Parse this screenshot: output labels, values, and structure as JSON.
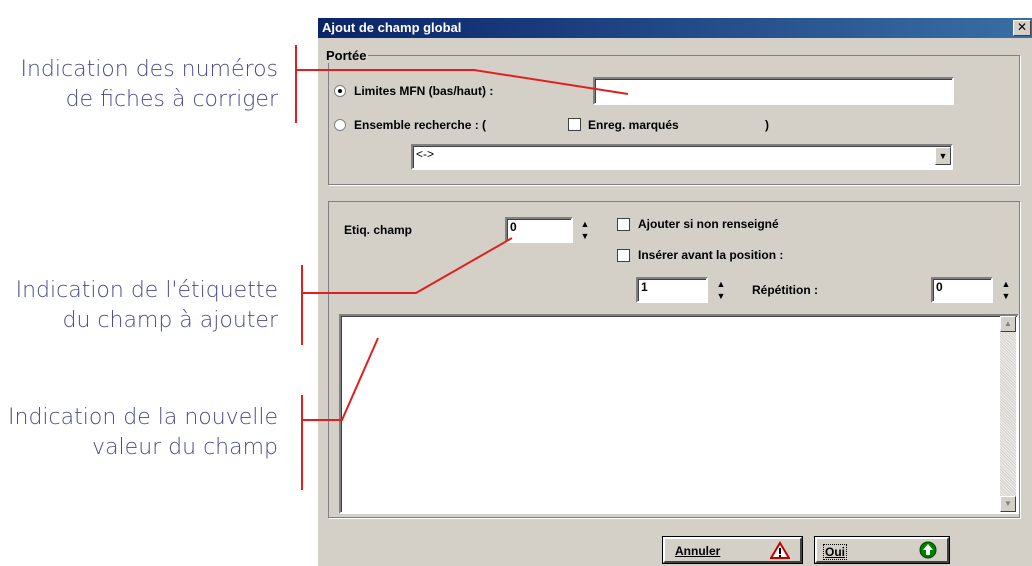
{
  "annotations": {
    "mfn_line1": "Indication des numéros",
    "mfn_line2": "de fiches à corriger",
    "tag_line1": "Indication de l'étiquette",
    "tag_line2": "du champ à ajouter",
    "value_line1": "Indication de la nouvelle",
    "value_line2": "valeur du champ"
  },
  "dialog": {
    "title": "Ajout de champ global",
    "close": "✕",
    "scope": {
      "legend": "Portée",
      "mfn_limits_label": "Limites MFN (bas/haut) :",
      "mfn_limits_value": "",
      "search_set_label": "Ensemble recherche : (",
      "marked_label": "Enreg. marqués",
      "close_paren": ")",
      "search_set_select": "<->",
      "mfn_selected": true
    },
    "field": {
      "tag_label": "Etiq. champ",
      "tag_value": "0",
      "add_if_empty_label": "Ajouter si non renseigné",
      "insert_before_label": "Insérer avant la position :",
      "position_value": "1",
      "repetition_label": "Répétition :",
      "repetition_value": "0",
      "new_value": ""
    },
    "buttons": {
      "cancel": "Annuler",
      "ok": "Oui"
    }
  },
  "colors": {
    "annotation_text": "#4a4a8a",
    "callout_line": "#e02020",
    "dialog_bg": "#d4d0c8",
    "title_start": "#0a246a",
    "title_end": "#3a6ea5"
  }
}
